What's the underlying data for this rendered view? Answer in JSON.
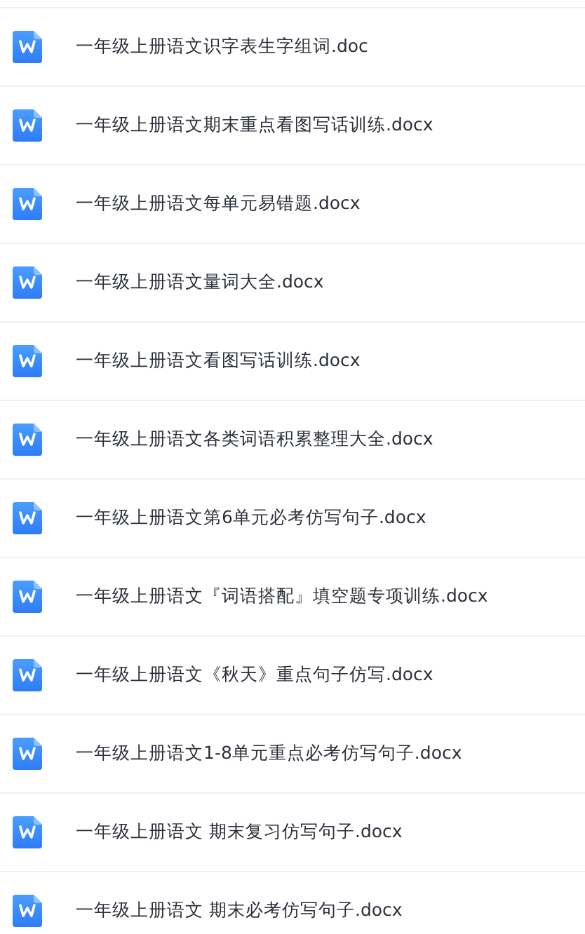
{
  "files": [
    {
      "name": "一年级上册语文识字表生字组词.doc"
    },
    {
      "name": "一年级上册语文期末重点看图写话训练.docx"
    },
    {
      "name": "一年级上册语文每单元易错题.docx"
    },
    {
      "name": "一年级上册语文量词大全.docx"
    },
    {
      "name": "一年级上册语文看图写话训练.docx"
    },
    {
      "name": "一年级上册语文各类词语积累整理大全.docx"
    },
    {
      "name": "一年级上册语文第6单元必考仿写句子.docx"
    },
    {
      "name": "一年级上册语文『词语搭配』填空题专项训练.docx"
    },
    {
      "name": "一年级上册语文《秋天》重点句子仿写.docx"
    },
    {
      "name": "一年级上册语文1-8单元重点必考仿写句子.docx"
    },
    {
      "name": "一年级上册语文 期末复习仿写句子.docx"
    },
    {
      "name": "一年级上册语文 期末必考仿写句子.docx"
    }
  ]
}
